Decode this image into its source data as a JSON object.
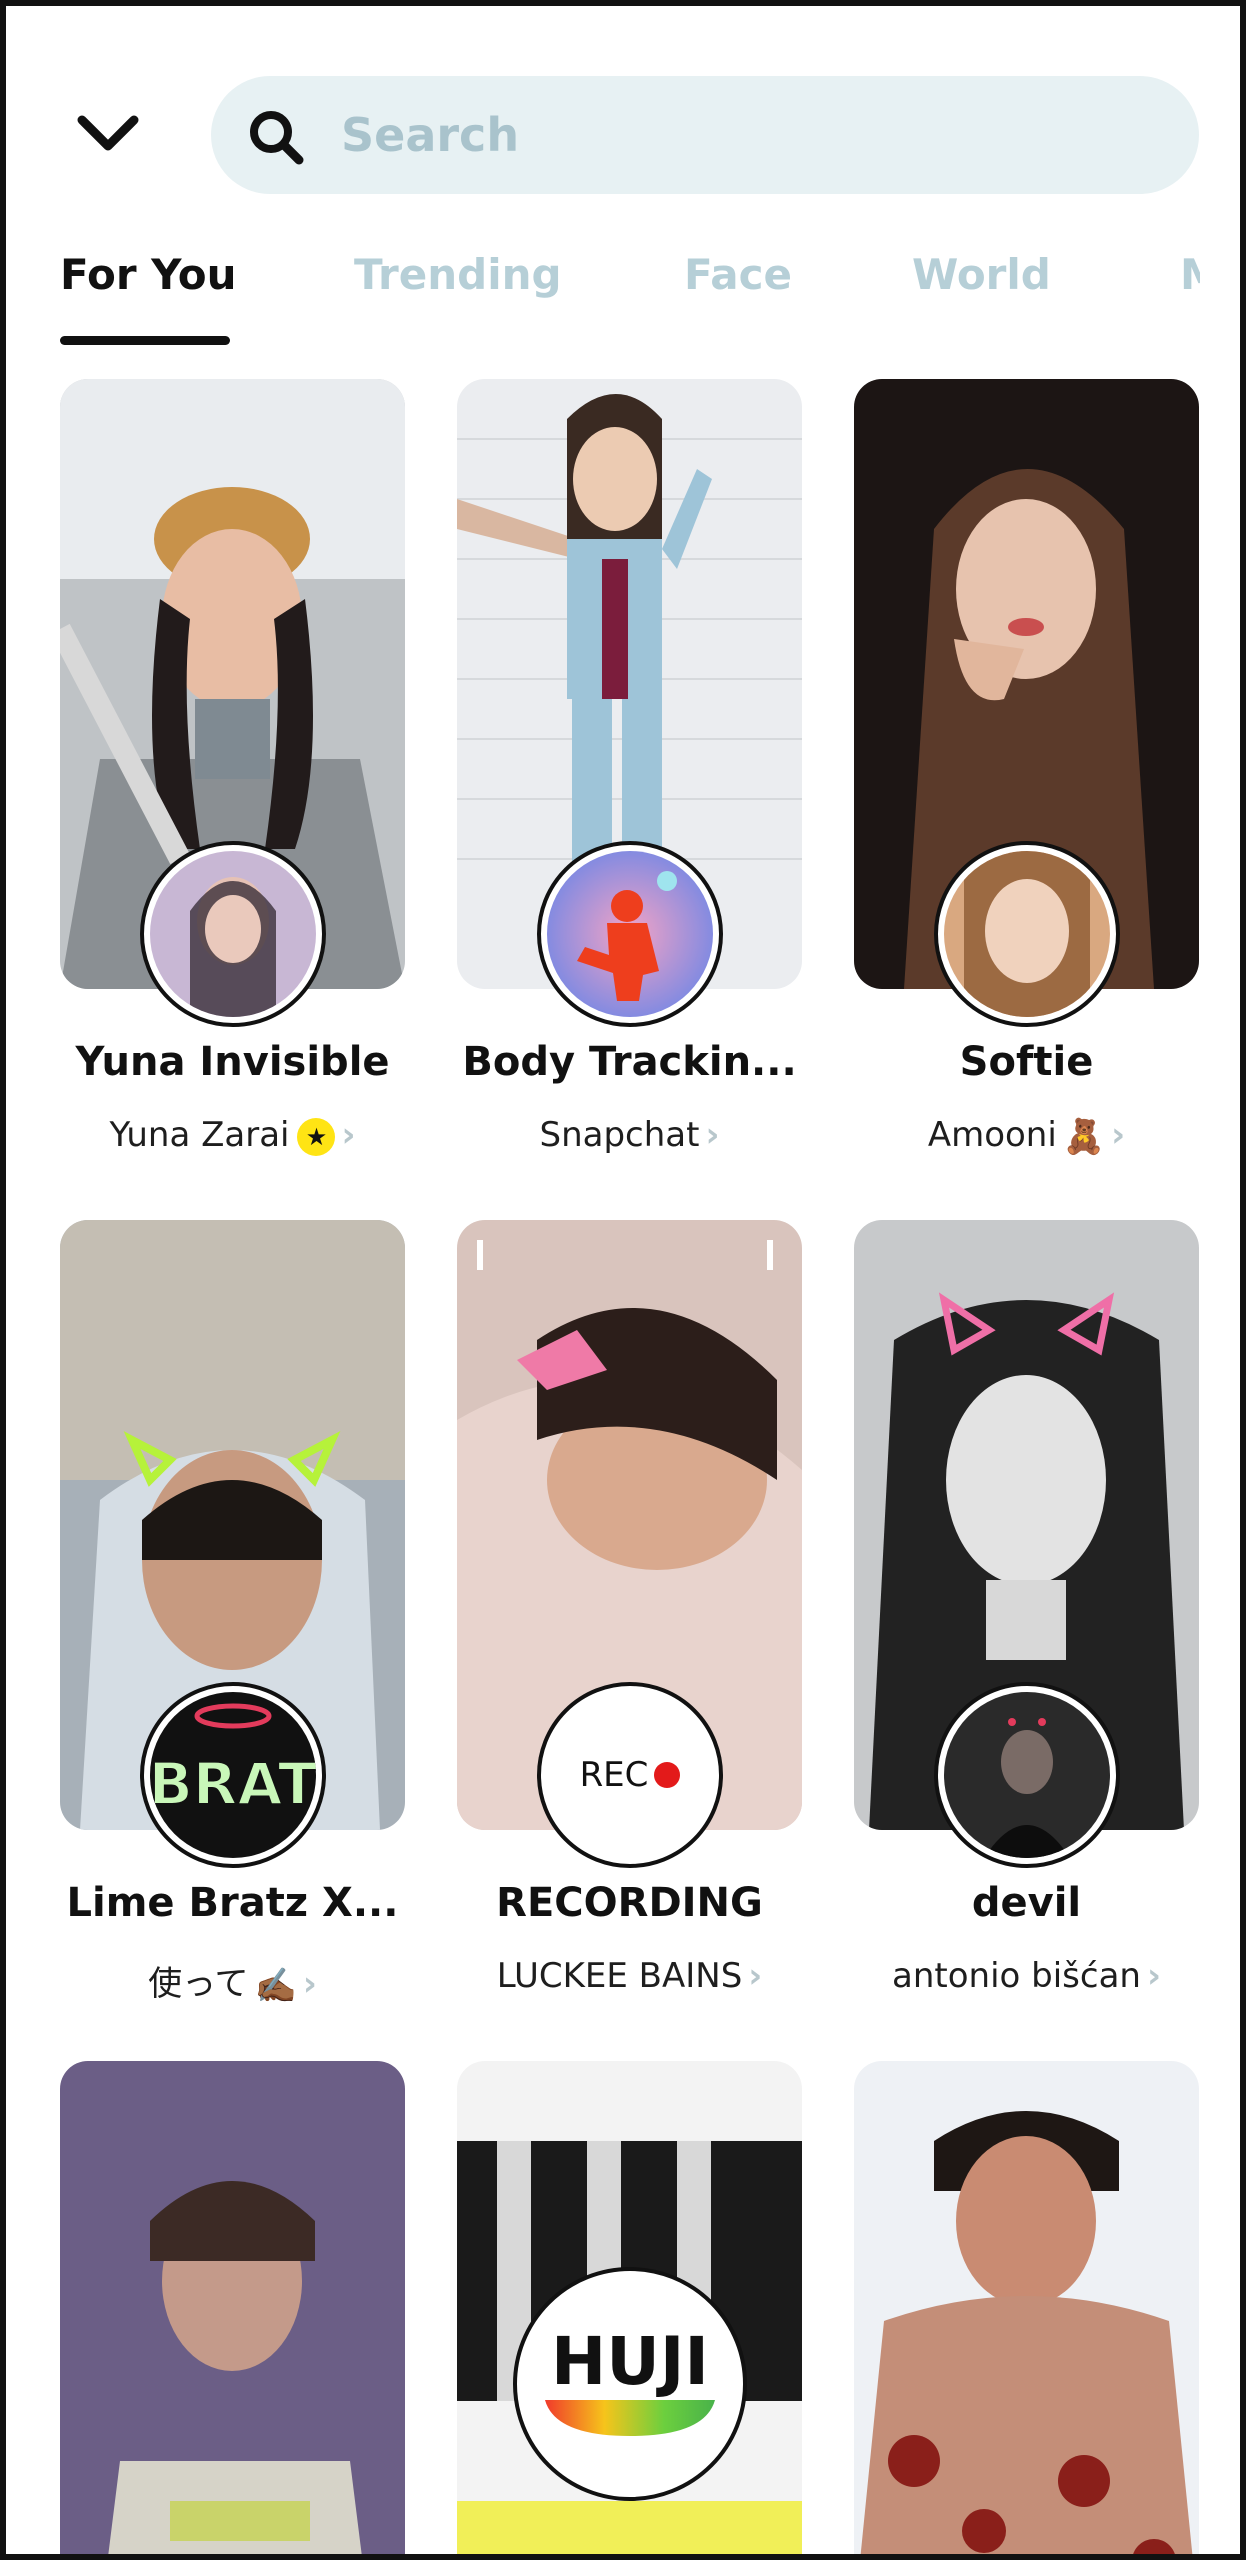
{
  "header": {
    "back_icon": "chevron-down-icon",
    "search_icon": "search-icon",
    "search_placeholder": "Search",
    "search_value": ""
  },
  "tabs": [
    {
      "label": "For You",
      "active": true
    },
    {
      "label": "Trending",
      "active": false
    },
    {
      "label": "Face",
      "active": false
    },
    {
      "label": "World",
      "active": false
    },
    {
      "label": "M",
      "active": false
    }
  ],
  "lenses": [
    {
      "title": "Yuna Invisible",
      "creator": "Yuna Zarai",
      "badge": "★",
      "chevron": "›"
    },
    {
      "title": "Body Trackin...",
      "creator": "Snapchat",
      "chevron": "›"
    },
    {
      "title": "Softie",
      "creator": "Amooni",
      "emoji": "🧸",
      "chevron": "›"
    },
    {
      "title": "Lime Bratz X...",
      "creator": "使って",
      "emoji": "✍🏾",
      "chevron": "›"
    },
    {
      "title": "RECORDING",
      "creator": "LUCKEE BAINS",
      "chevron": "›",
      "avatar_text": "REC"
    },
    {
      "title": "devil",
      "creator": "antonio bišćan",
      "chevron": "›"
    },
    {
      "title": "",
      "creator": ""
    },
    {
      "title": "",
      "creator": "",
      "avatar_text": "HUJI"
    },
    {
      "title": "",
      "creator": ""
    }
  ],
  "colors": {
    "search_bg": "#e7f1f3",
    "tab_inactive": "#b6cfd7",
    "tab_active": "#111111",
    "badge_yellow": "#ffe414",
    "rec_red": "#e31a1a"
  }
}
